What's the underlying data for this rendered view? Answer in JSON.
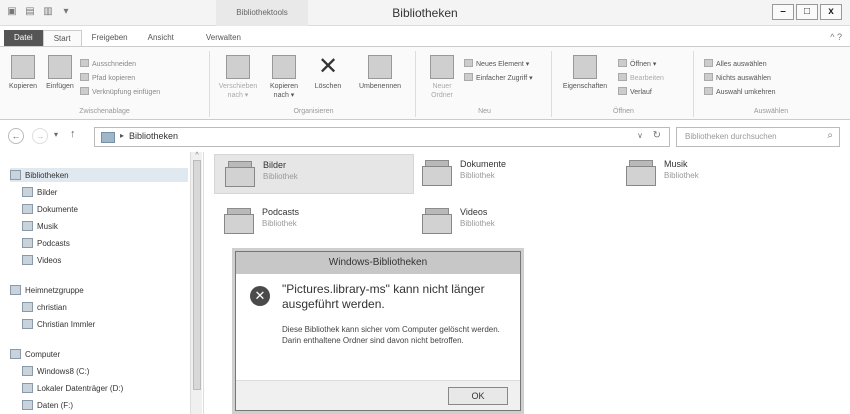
{
  "window": {
    "title": "Bibliotheken",
    "tools_tab": "Bibliothektools",
    "buttons": [
      "–",
      "□",
      "x"
    ]
  },
  "ribbon_tabs": [
    "Datei",
    "Start",
    "Freigeben",
    "Ansicht",
    "Verwalten"
  ],
  "ribbon_right": "^  ?",
  "ribbon": {
    "clipboard": {
      "label": "Zwischenablage",
      "copy": "Kopieren",
      "paste": "Einfügen",
      "cut": "Ausschneiden",
      "copy_path": "Pfad kopieren",
      "paste_shortcut": "Verknüpfung einfügen"
    },
    "organize": {
      "label": "Organisieren",
      "move": "Verschieben nach ▾",
      "copy_to": "Kopieren nach ▾",
      "delete": "Löschen",
      "rename": "Umbenennen"
    },
    "new": {
      "label": "Neu",
      "new_folder": "Neuer Ordner",
      "new_item": "Neues Element ▾",
      "easy_access": "Einfacher Zugriff ▾"
    },
    "open": {
      "label": "Öffnen",
      "properties": "Eigenschaften",
      "open": "Öffnen ▾",
      "edit": "Bearbeiten",
      "history": "Verlauf"
    },
    "select": {
      "label": "Auswählen",
      "select_all": "Alles auswählen",
      "select_none": "Nichts auswählen",
      "invert": "Auswahl umkehren"
    }
  },
  "address": {
    "crumb": "Bibliotheken",
    "search_placeholder": "Bibliotheken durchsuchen"
  },
  "nav": {
    "libraries": "Bibliotheken",
    "library_items": [
      "Bilder",
      "Dokumente",
      "Musik",
      "Podcasts",
      "Videos"
    ],
    "homegroup": "Heimnetzgruppe",
    "homegroup_items": [
      "christian",
      "Christian Immler"
    ],
    "computer": "Computer",
    "computer_items": [
      "Windows8 (C:)",
      "Lokaler Datenträger (D:)",
      "Daten (F:)"
    ]
  },
  "libraries": [
    {
      "name": "Bilder",
      "type": "Bibliothek"
    },
    {
      "name": "Dokumente",
      "type": "Bibliothek"
    },
    {
      "name": "Musik",
      "type": "Bibliothek"
    },
    {
      "name": "Podcasts",
      "type": "Bibliothek"
    },
    {
      "name": "Videos",
      "type": "Bibliothek"
    }
  ],
  "dialog": {
    "title": "Windows-Bibliotheken",
    "message": "\"Pictures.library-ms\" kann nicht länger ausgeführt werden.",
    "detail": "Diese Bibliothek kann sicher vom Computer gelöscht werden. Darin enthaltene Ordner sind davon nicht betroffen.",
    "ok": "OK"
  }
}
